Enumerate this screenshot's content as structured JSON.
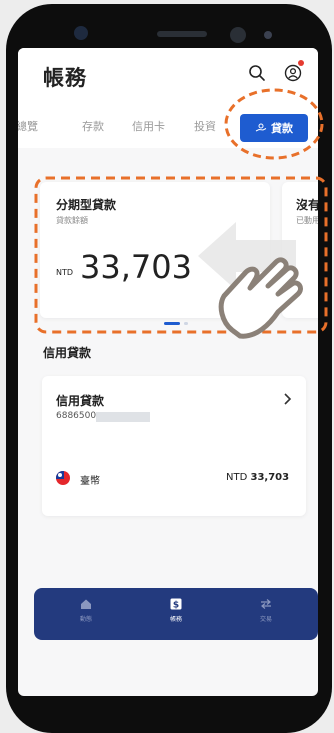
{
  "header": {
    "title": "帳務"
  },
  "tabs": [
    {
      "label": "總覽"
    },
    {
      "label": "存款"
    },
    {
      "label": "信用卡"
    },
    {
      "label": "投資"
    },
    {
      "label": "貸款",
      "active": true
    }
  ],
  "loan_cards": [
    {
      "title": "分期型貸款",
      "subtitle": "貸款餘額",
      "currency": "NTD",
      "amount": "33,703"
    },
    {
      "title": "沒有餘",
      "subtitle": "已動用"
    }
  ],
  "credit_loan": {
    "section_title": "信用貸款",
    "card_title": "信用貸款",
    "account_number": "6886500",
    "currency_name": "臺幣",
    "amount_currency": "NTD",
    "amount": "33,703"
  },
  "bottom_nav": [
    {
      "label": "動態",
      "icon": "home-icon"
    },
    {
      "label": "帳務",
      "icon": "dollar-icon",
      "active": true
    },
    {
      "label": "交易",
      "icon": "transfer-icon"
    }
  ],
  "colors": {
    "brand_blue": "#1e5cd0",
    "nav_bg": "#233a7e",
    "annotation_orange": "#e8702a",
    "alert_red": "#e53b30"
  }
}
